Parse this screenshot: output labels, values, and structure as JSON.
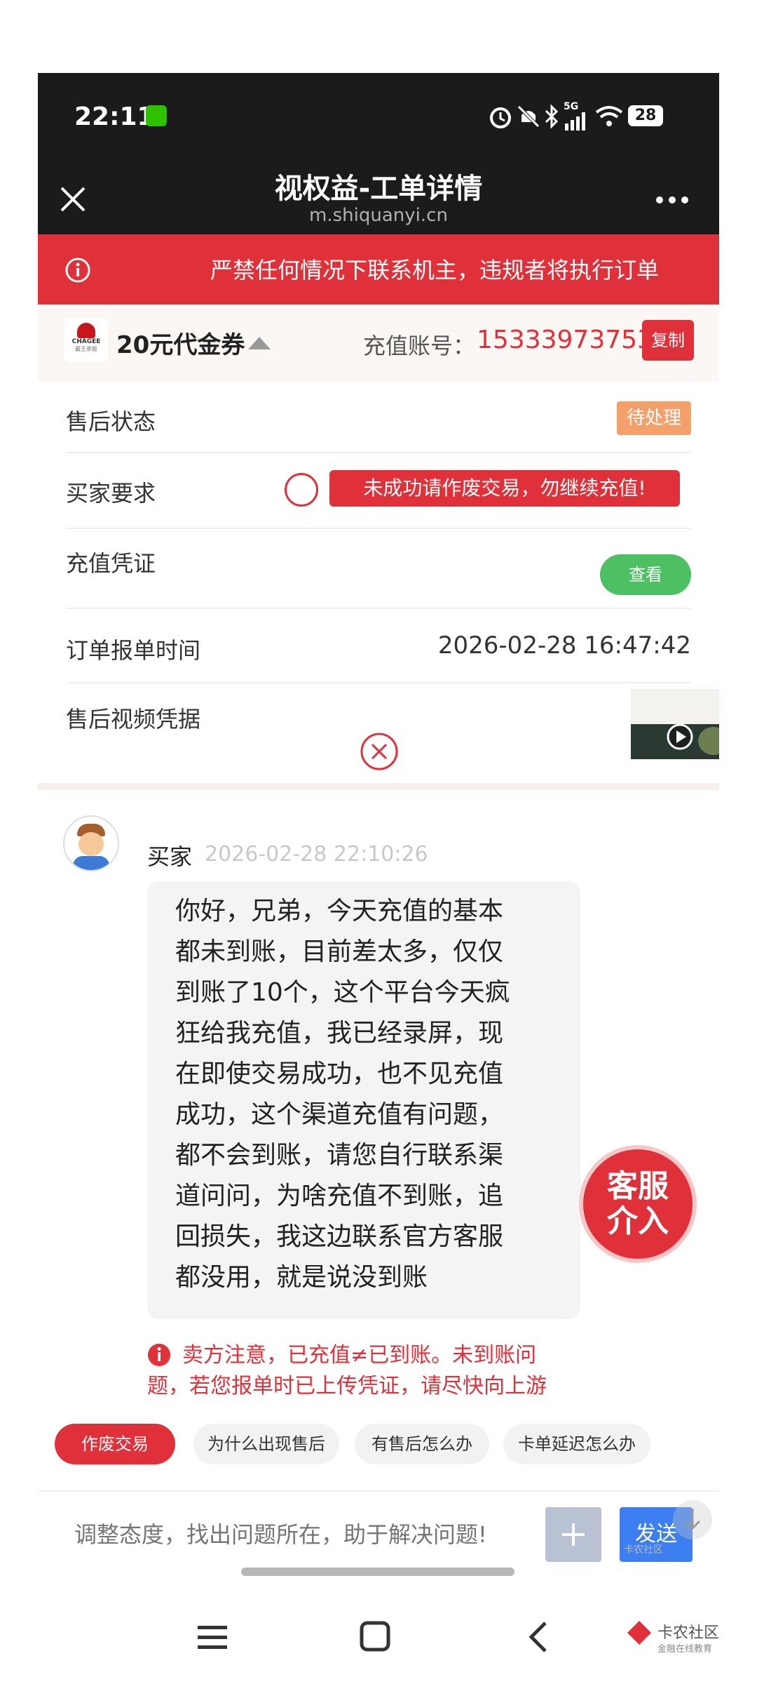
{
  "status_bar": {
    "time": "22:11",
    "battery": "28",
    "network": "5G"
  },
  "titlebar": {
    "title": "视权益-工单详情",
    "subtitle": "m.shiquanyi.cn"
  },
  "banner": {
    "text": "严禁任何情况下联系机主，违规者将执行订单"
  },
  "product": {
    "logo_text": "CHAGEE",
    "logo_sub": "霸王茶姬",
    "name": "20元代金券",
    "account_label": "充值账号：",
    "account_value": "15333973753",
    "copy_label": "复制"
  },
  "details": {
    "after_sale_label": "售后状态",
    "after_sale_status": "待处理",
    "buyer_request_label": "买家要求",
    "buyer_request_text": "未成功请作废交易，勿继续充值!",
    "proof_label": "充值凭证",
    "proof_button": "查看",
    "order_time_label": "订单报单时间",
    "order_time_value": "2026-02-28 16:47:42",
    "video_label": "售后视频凭据"
  },
  "chat": {
    "sender": "买家",
    "timestamp": "2026-02-28 22:10:26",
    "message_lines": [
      "你好，兄弟，今天充值的基本",
      "都未到账，目前差太多，仅仅",
      "到账了10个，这个平台今天疯",
      "狂给我充值，我已经录屏，现",
      "在即使交易成功，也不见充值",
      "成功，这个渠道充值有问题，",
      "都不会到账，请您自行联系渠",
      "道问问，为啥充值不到账，追",
      "回损失，我这边联系官方客服",
      "都没用，就是说没到账"
    ],
    "notice_line1": "卖方注意，已充值≠已到账。未到账问",
    "notice_line2": "题，若您报单时已上传凭证，请尽快向上游",
    "service_badge_line1": "客服",
    "service_badge_line2": "介入"
  },
  "quick_actions": [
    "作废交易",
    "为什么出现售后",
    "有售后怎么办",
    "卡单延迟怎么办"
  ],
  "input": {
    "placeholder": "调整态度，找出问题所在，助于解决问题!",
    "send_label": "发送"
  },
  "watermark": {
    "name": "卡农社区",
    "slogan": "金融在线教育"
  },
  "colors": {
    "accent_red": "#e0303a",
    "status_orange": "#f4a06a",
    "green": "#4cc063",
    "send_blue": "#3d7ef0"
  }
}
